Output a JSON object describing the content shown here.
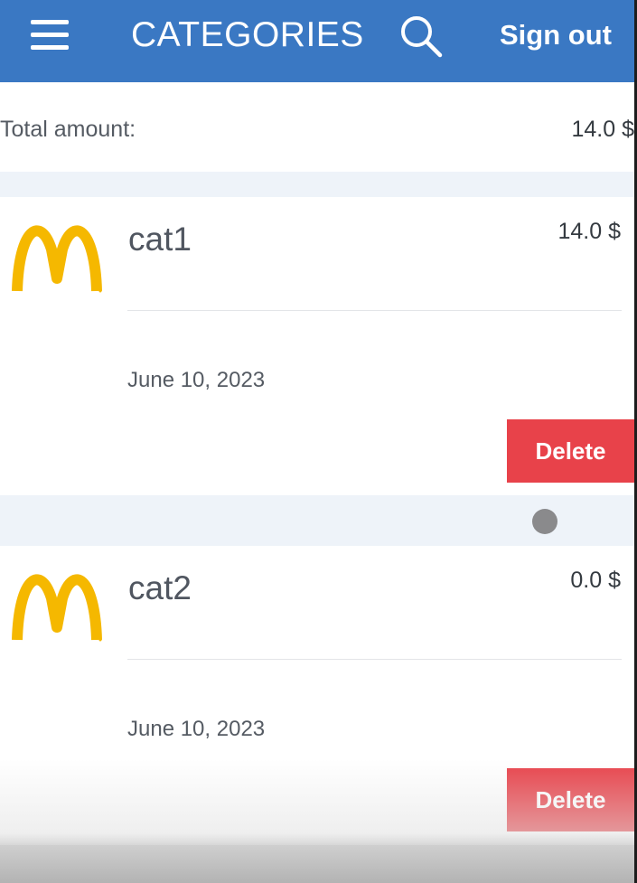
{
  "header": {
    "title": "CATEGORIES",
    "sign_out_label": "Sign out",
    "menu_icon": "hamburger-menu-icon",
    "search_icon": "search-icon",
    "background_color": "#3a78c3"
  },
  "summary": {
    "total_label": "Total amount:",
    "total_value": "14.0 $"
  },
  "categories": [
    {
      "name": "cat1",
      "amount": "14.0 $",
      "date": "June 10, 2023",
      "icon": "mcdonalds-logo",
      "delete_label": "Delete"
    },
    {
      "name": "cat2",
      "amount": "0.0 $",
      "date": "June 10, 2023",
      "icon": "mcdonalds-logo",
      "delete_label": "Delete"
    }
  ],
  "colors": {
    "delete_button": "#e8424a",
    "logo": "#f5b800",
    "section_gap": "#eef3f9"
  }
}
